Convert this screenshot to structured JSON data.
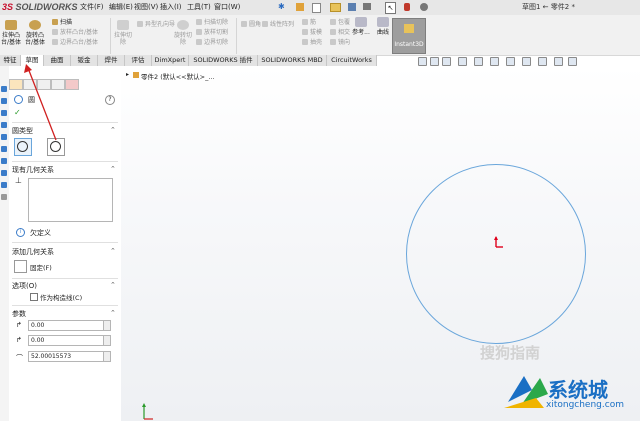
{
  "app": {
    "logo_ds": "3S",
    "logo_sw": "SOLIDWORKS",
    "document_title": "草图1 ← 零件2 *"
  },
  "menu": [
    "文件(F)",
    "编辑(E)",
    "视图(V)",
    "插入(I)",
    "工具(T)",
    "窗口(W)"
  ],
  "ribbon": {
    "extrude_boss": "拉伸凸\n台/基体",
    "revolve_boss": "旋转凸\n台/基体",
    "sweep": "扫描",
    "loft_boss": "放样凸台/基体",
    "boundary_boss": "边界凸台/基体",
    "cut_extrude": "拉伸切\n除",
    "hole_wizard": "异型孔向导",
    "revolve_cut": "旋转切\n除",
    "sweep_cut": "扫描切除",
    "loft_cut": "放样切割",
    "boundary_cut": "边界切除",
    "fillet": "圆角",
    "linear_pattern": "线性阵列",
    "rib": "筋",
    "draft": "拔模",
    "shell": "抽壳",
    "wrap": "包覆",
    "intersect": "相交",
    "mirror": "镜向",
    "reference": "参考...",
    "curves": "曲线",
    "instant3d": "Instant3D"
  },
  "tabs": [
    "特征",
    "草图",
    "曲面",
    "钣金",
    "焊件",
    "评估",
    "DimXpert",
    "SOLIDWORKS 插件",
    "SOLIDWORKS MBD",
    "CircuitWorks"
  ],
  "tree": {
    "node": "零件2 (默认<<默认>_..."
  },
  "property_manager": {
    "title": "圆",
    "help": "?",
    "section_circle_type": "圆类型",
    "section_existing_relations": "现有几何关系",
    "under_defined": "欠定义",
    "section_add_relations": "添加几何关系",
    "fix_button": "固定(F)",
    "section_options": "选项(O)",
    "construction_label": "作为构造线(C)",
    "section_parameters": "参数",
    "param_cx": "0.00",
    "param_cy": "0.00",
    "param_radius": "52.00015573"
  },
  "watermark": {
    "sogou": "搜狗指南",
    "brand": "系统城",
    "url": "xitongcheng.com"
  },
  "colors": {
    "circle": "#6aa6db",
    "accent": "#3b7cc9",
    "origin": "#e0001b"
  }
}
